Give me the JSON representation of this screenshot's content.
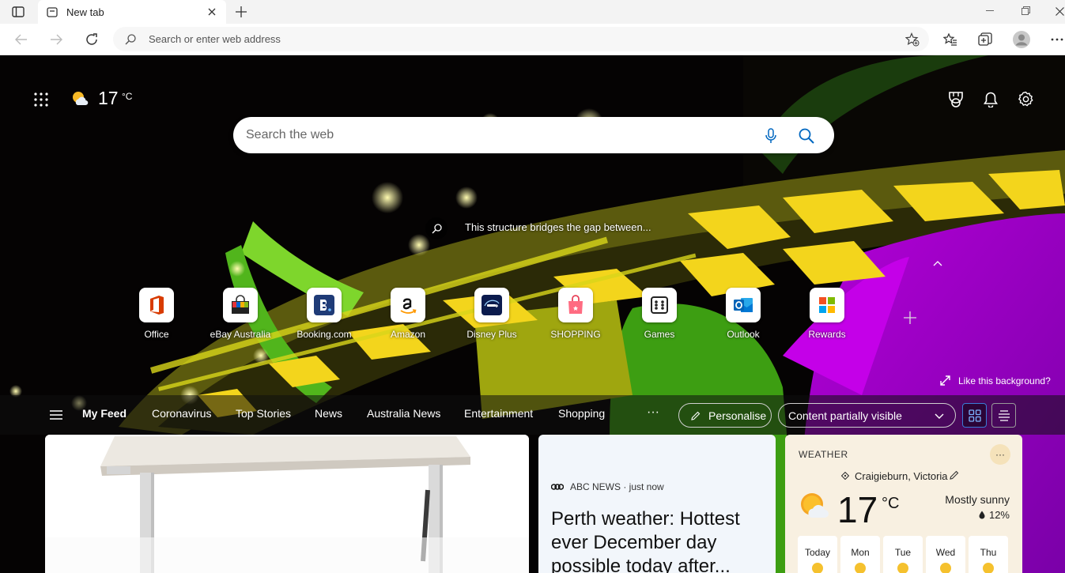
{
  "browser": {
    "tab": {
      "title": "New tab"
    },
    "address": {
      "placeholder": "Search or enter web address"
    }
  },
  "ntp": {
    "weather_chip": {
      "temp": "17",
      "unit": "°C"
    },
    "search": {
      "placeholder": "Search the web"
    },
    "image_caption": "This structure bridges the gap between...",
    "quick_links": [
      {
        "label": "Office"
      },
      {
        "label": "eBay Australia"
      },
      {
        "label": "Booking.com"
      },
      {
        "label": "Amazon"
      },
      {
        "label": "Disney Plus"
      },
      {
        "label": "SHOPPING"
      },
      {
        "label": "Games"
      },
      {
        "label": "Outlook"
      },
      {
        "label": "Rewards"
      }
    ],
    "like_background": "Like this background?",
    "feed_nav": {
      "items": [
        "My Feed",
        "Coronavirus",
        "Top Stories",
        "News",
        "Australia News",
        "Entertainment",
        "Shopping"
      ],
      "more": "···",
      "personalise": "Personalise",
      "visibility": "Content partially visible"
    },
    "news_card": {
      "source": "ABC NEWS · just now",
      "headline": "Perth weather: Hottest ever December day possible today after..."
    },
    "weather_card": {
      "title": "WEATHER",
      "more": "···",
      "location": "Craigieburn, Victoria",
      "temp": "17",
      "unit": "°C",
      "condition": "Mostly sunny",
      "precip": "12%",
      "days": [
        "Today",
        "Mon",
        "Tue",
        "Wed",
        "Thu"
      ]
    }
  },
  "colors": {
    "accent": "#0067c0",
    "background": "#050303"
  }
}
